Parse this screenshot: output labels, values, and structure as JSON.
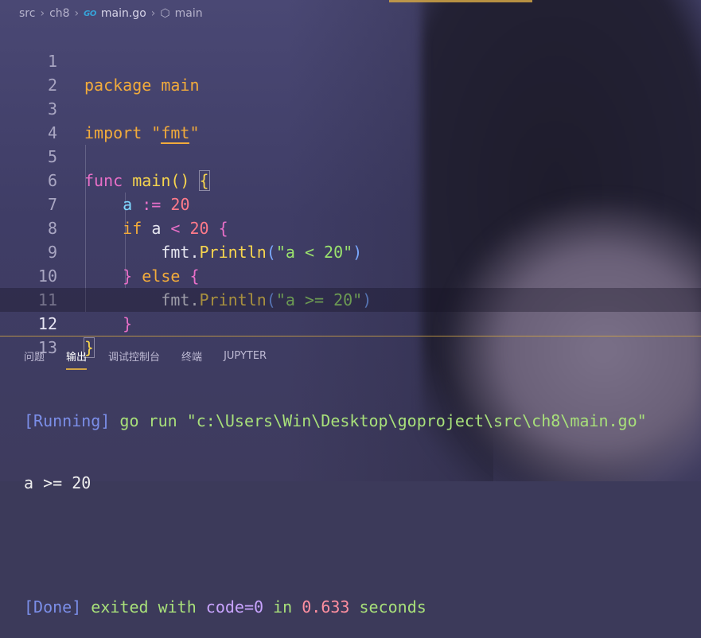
{
  "breadcrumb": {
    "items": [
      "src",
      "ch8",
      "main.go",
      "main"
    ],
    "go_icon": "GO"
  },
  "editor": {
    "line_numbers": [
      "1",
      "2",
      "3",
      "4",
      "5",
      "6",
      "7",
      "8",
      "9",
      "10",
      "11",
      "12",
      "13"
    ],
    "current_line": "12",
    "tokens": {
      "package_kw": "package",
      "main_pkg": "main",
      "import_kw": "import",
      "quote": "\"",
      "fmt": "fmt",
      "func_kw": "func",
      "main_fn": "main",
      "parens": "()",
      "lbrace": "{",
      "rbrace": "}",
      "a": "a",
      "assign": ":=",
      "twenty": "20",
      "if_kw": "if",
      "lt": "<",
      "fmt_pkg": "fmt",
      "dot": ".",
      "println": "Println",
      "lparen": "(",
      "rparen": ")",
      "str1": "\"a < 20\"",
      "else_kw": "else",
      "str2": "\"a >= 20\""
    }
  },
  "panel": {
    "tabs": [
      "问题",
      "输出",
      "调试控制台",
      "终端",
      "JUPYTER"
    ],
    "active_tab": "输出",
    "output": {
      "running_tag": "[Running]",
      "running_cmd": "go run \"c:\\Users\\Win\\Desktop\\goproject\\src\\ch8\\main.go\"",
      "result": "a >= 20",
      "done_tag": "[Done]",
      "exited_with": "exited with",
      "code_label": "code=0",
      "in_word": "in",
      "seconds_value": "0.633",
      "seconds_word": "seconds"
    }
  },
  "colors": {
    "accent": "#d1a445",
    "keyword": "#f2ab3b",
    "control": "#e86fc8",
    "function": "#f7d54e",
    "variable": "#7fd7ff",
    "number": "#ff7a8a",
    "string": "#9be36d"
  }
}
